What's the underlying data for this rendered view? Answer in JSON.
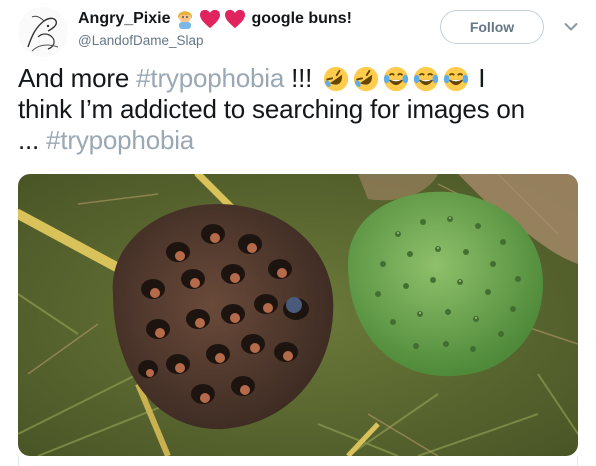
{
  "author": {
    "display_name": "Angry_Pixie",
    "name_suffix": "google buns!",
    "handle": "@LandofDame_Slap",
    "name_emojis": [
      "person-emoji",
      "red-heart-emoji",
      "red-heart-emoji"
    ]
  },
  "actions": {
    "follow_label": "Follow",
    "menu_icon": "chevron-down-icon"
  },
  "tweet": {
    "line1_text": "And more ",
    "line1_hashtag": "#trypophobia",
    "line1_after": " !!! ",
    "emojis": [
      "rofl-emoji",
      "rofl-emoji",
      "joy-emoji",
      "joy-emoji",
      "joy-emoji"
    ],
    "line1_tail": " I",
    "line2_text": "think I’m addicted to searching for images on",
    "line3_text": "... ",
    "line3_hashtag": "#trypophobia"
  },
  "media": {
    "description_icon": "lotus-seed-pods-photo"
  },
  "colors": {
    "text": "#14171a",
    "secondary": "#657786",
    "hashtag": "#8899a6",
    "heart": "#e0245e"
  }
}
